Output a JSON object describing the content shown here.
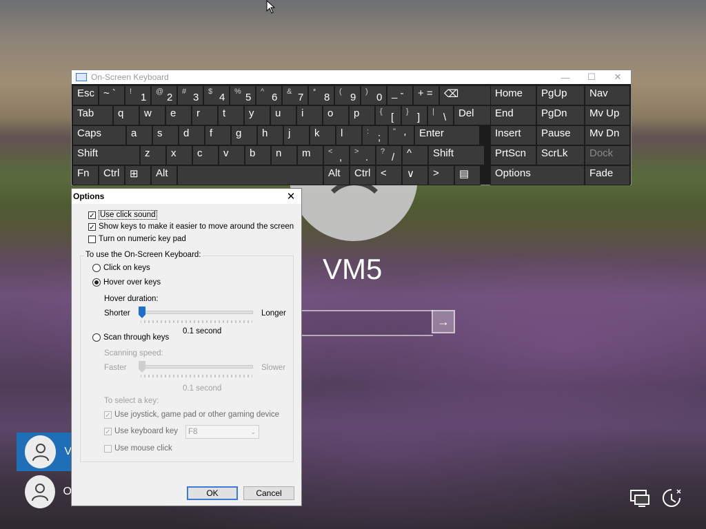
{
  "login": {
    "display_name": "VM5",
    "users": [
      {
        "initial": "V",
        "selected": true
      },
      {
        "initial": "O",
        "selected": false
      }
    ],
    "submit_icon": "arrow-right-icon"
  },
  "osk": {
    "title": "On-Screen Keyboard",
    "rows": [
      [
        {
          "label": "Esc"
        },
        {
          "label": "~ `"
        },
        {
          "sup": "!",
          "main": "1"
        },
        {
          "sup": "@",
          "main": "2"
        },
        {
          "sup": "#",
          "main": "3"
        },
        {
          "sup": "$",
          "main": "4"
        },
        {
          "sup": "%",
          "main": "5"
        },
        {
          "sup": "^",
          "main": "6"
        },
        {
          "sup": "&",
          "main": "7"
        },
        {
          "sup": "*",
          "main": "8"
        },
        {
          "sup": "(",
          "main": "9"
        },
        {
          "sup": ")",
          "main": "0"
        },
        {
          "label": "_ -"
        },
        {
          "label": "+ ="
        },
        {
          "label": "⌫"
        }
      ],
      [
        {
          "label": "Tab"
        },
        {
          "label": "q"
        },
        {
          "label": "w"
        },
        {
          "label": "e"
        },
        {
          "label": "r"
        },
        {
          "label": "t"
        },
        {
          "label": "y"
        },
        {
          "label": "u"
        },
        {
          "label": "i"
        },
        {
          "label": "o"
        },
        {
          "label": "p"
        },
        {
          "sup": "{",
          "main": "["
        },
        {
          "sup": "}",
          "main": "]"
        },
        {
          "sup": "|",
          "main": "\\"
        },
        {
          "label": "Del"
        }
      ],
      [
        {
          "label": "Caps"
        },
        {
          "label": "a"
        },
        {
          "label": "s"
        },
        {
          "label": "d"
        },
        {
          "label": "f"
        },
        {
          "label": "g"
        },
        {
          "label": "h"
        },
        {
          "label": "j"
        },
        {
          "label": "k"
        },
        {
          "label": "l"
        },
        {
          "sup": ":",
          "main": ";"
        },
        {
          "sup": "\"",
          "main": "'"
        },
        {
          "label": "Enter"
        }
      ],
      [
        {
          "label": "Shift"
        },
        {
          "label": "z"
        },
        {
          "label": "x"
        },
        {
          "label": "c"
        },
        {
          "label": "v"
        },
        {
          "label": "b"
        },
        {
          "label": "n"
        },
        {
          "label": "m"
        },
        {
          "sup": "<",
          "main": ","
        },
        {
          "sup": ">",
          "main": "."
        },
        {
          "sup": "?",
          "main": "/"
        },
        {
          "label": "^"
        },
        {
          "label": "Shift"
        }
      ],
      [
        {
          "label": "Fn"
        },
        {
          "label": "Ctrl"
        },
        {
          "label": "⊞"
        },
        {
          "label": "Alt"
        },
        {
          "label": ""
        },
        {
          "label": "Alt"
        },
        {
          "label": "Ctrl"
        },
        {
          "label": "<"
        },
        {
          "label": "∨"
        },
        {
          "label": ">"
        },
        {
          "label": "▤"
        }
      ]
    ],
    "nav_keys": [
      [
        "Home",
        "PgUp",
        "Nav"
      ],
      [
        "End",
        "PgDn",
        "Mv Up"
      ],
      [
        "Insert",
        "Pause",
        "Mv Dn"
      ],
      [
        "PrtScn",
        "ScrLk",
        "Dock"
      ],
      [
        "Options",
        "Fade"
      ]
    ]
  },
  "options": {
    "title": "Options",
    "use_click_sound": "Use click sound",
    "show_keys": "Show keys to make it easier to move around the screen",
    "numeric_pad": "Turn on numeric key pad",
    "group_label": "To use the On-Screen Keyboard:",
    "click_on_keys": "Click on keys",
    "hover_over_keys": "Hover over keys",
    "hover_duration": "Hover duration:",
    "shorter": "Shorter",
    "longer": "Longer",
    "hover_value": "0.1 second",
    "scan_through_keys": "Scan through keys",
    "scanning_speed": "Scanning speed:",
    "faster": "Faster",
    "slower": "Slower",
    "scan_value": "0.1 second",
    "to_select_key": "To select a key:",
    "use_joystick": "Use joystick, game pad or other gaming device",
    "use_keyboard_key": "Use keyboard key",
    "keyboard_key_value": "F8",
    "use_mouse_click": "Use mouse click",
    "ok": "OK",
    "cancel": "Cancel",
    "checks": {
      "click_sound": true,
      "show_keys": true,
      "numeric_pad": false,
      "joystick": true,
      "keyboard_key": true,
      "mouse_click": false
    },
    "mode": "hover"
  }
}
